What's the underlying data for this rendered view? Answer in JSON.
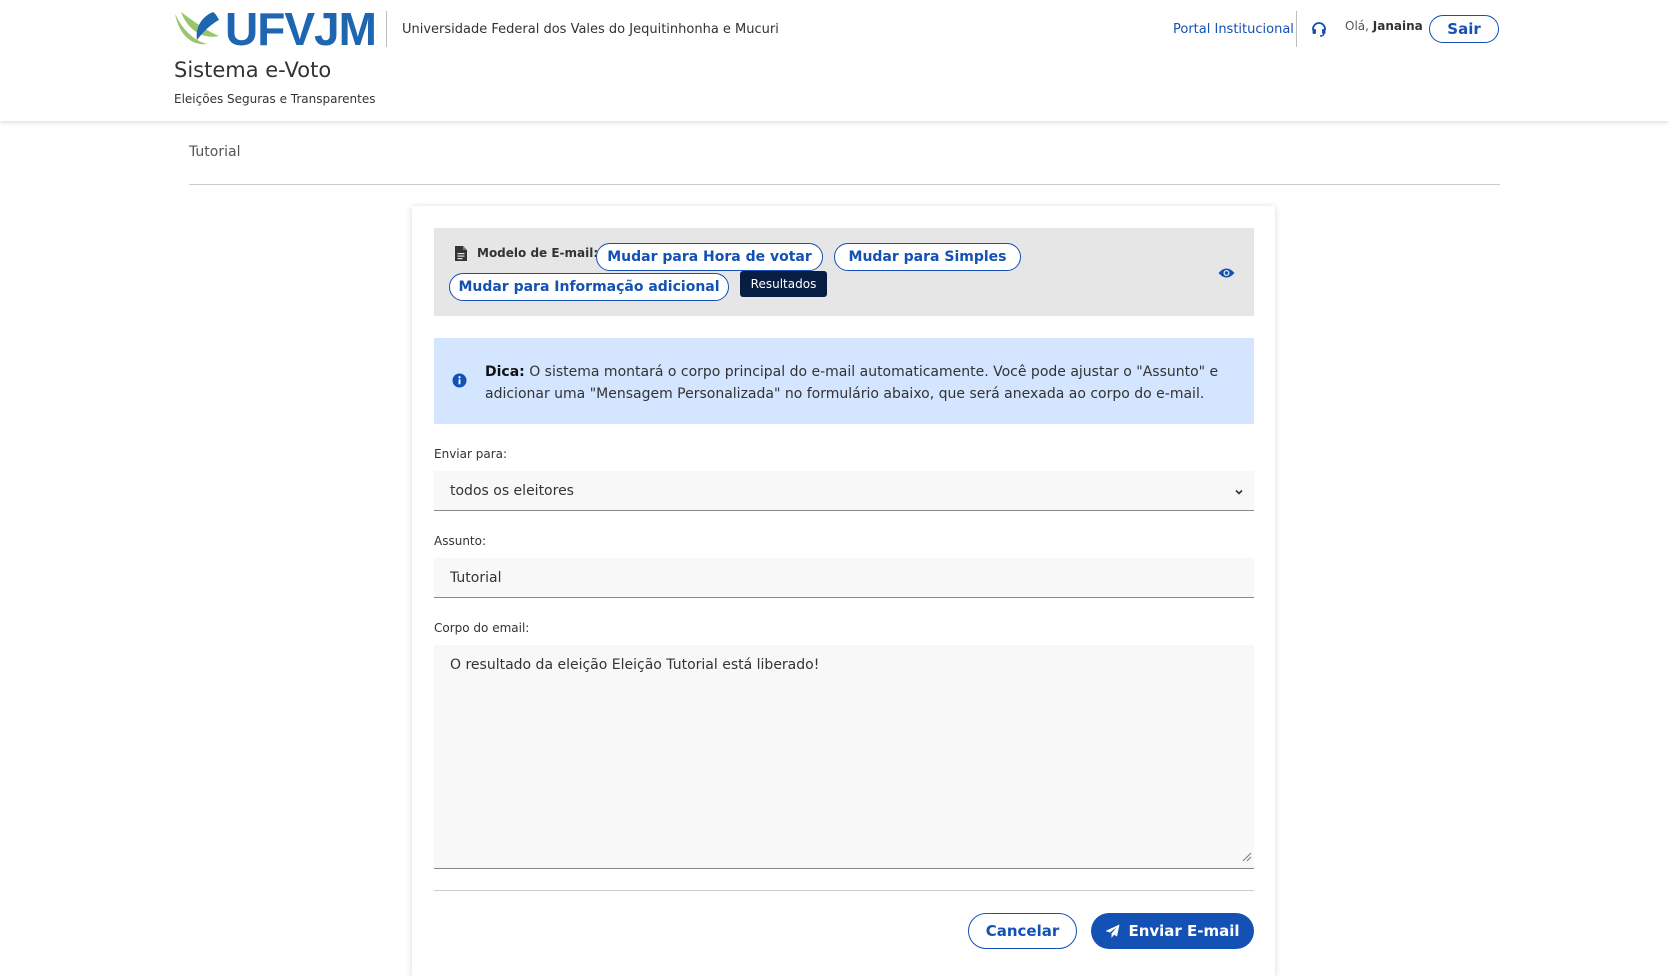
{
  "header": {
    "logo_text": "UFVJM",
    "university_name": "Universidade Federal dos Vales do Jequitinhonha e Mucuri",
    "system_title": "Sistema e-Voto",
    "system_subtitle": "Eleições Seguras e Transparentes",
    "portal_link": "Portal Institucional",
    "greeting_prefix": "Olá, ",
    "user_name": "Janaina",
    "logout_label": "Sair"
  },
  "breadcrumb": "Tutorial",
  "template_bar": {
    "label": "Modelo de E-mail:",
    "buttons": [
      {
        "label": "Mudar para Hora de votar"
      },
      {
        "label": "Mudar para Simples"
      },
      {
        "label": "Mudar para Informação adicional"
      }
    ],
    "tooltip": "Resultados"
  },
  "tip": {
    "title": "Dica:",
    "text": " O sistema montará o corpo principal do e-mail automaticamente. Você pode ajustar o \"Assunto\" e adicionar uma \"Mensagem Personalizada\" no formulário abaixo, que será anexada ao corpo do e-mail."
  },
  "form": {
    "send_to_label": "Enviar para:",
    "send_to_value": "todos os eleitores",
    "subject_label": "Assunto:",
    "subject_value": "Tutorial",
    "body_label": "Corpo do email:",
    "body_value": "O resultado da eleição Eleição Tutorial está liberado!"
  },
  "actions": {
    "cancel_label": "Cancelar",
    "send_label": "Enviar E-mail"
  },
  "colors": {
    "primary": "#1351b4",
    "logo_blue": "#1f66b1",
    "logo_green": "#9bc46f",
    "tip_bg": "#d4e5ff",
    "tooltip_bg": "#071d41"
  },
  "icons": [
    "ufvjm-leaf-icon",
    "headset-icon",
    "document-icon",
    "eye-icon",
    "info-icon",
    "chevron-down-icon",
    "paper-plane-icon",
    "resize-handle-icon"
  ]
}
